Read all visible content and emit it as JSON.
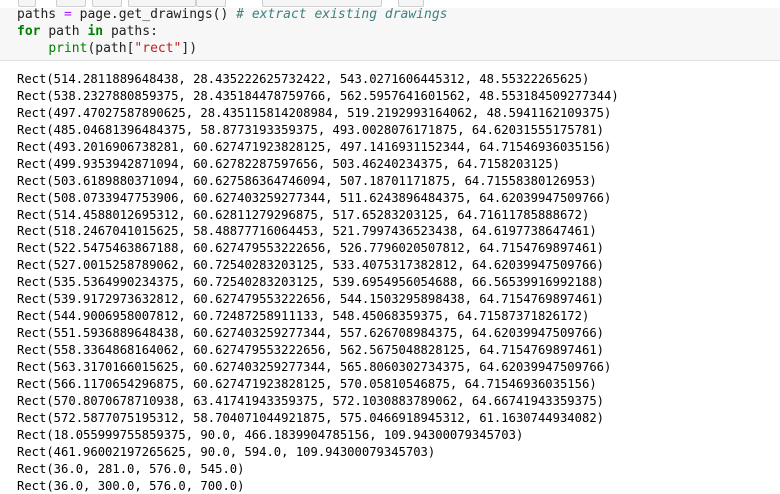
{
  "code": {
    "line1": {
      "lhs": "paths",
      "eq": "=",
      "rhs": "page.get_drawings()",
      "comment": "# extract existing drawings"
    },
    "line2": {
      "kw_for": "for",
      "var": "path",
      "kw_in": "in",
      "iter": "paths:"
    },
    "line3": {
      "indent": "    ",
      "fn": "print",
      "open": "(path[",
      "str": "\"rect\"",
      "close": "])"
    }
  },
  "output_lines": [
    "Rect(514.2811889648438, 28.435222625732422, 543.0271606445312, 48.55322265625)",
    "Rect(538.2327880859375, 28.435184478759766, 562.5957641601562, 48.553184509277344)",
    "Rect(497.47027587890625, 28.435115814208984, 519.2192993164062, 48.5941162109375)",
    "Rect(485.04681396484375, 58.8773193359375, 493.0028076171875, 64.62031555175781)",
    "Rect(493.2016906738281, 60.627471923828125, 497.1416931152344, 64.71546936035156)",
    "Rect(499.9353942871094, 60.62782287597656, 503.46240234375, 64.7158203125)",
    "Rect(503.6189880371094, 60.627586364746094, 507.18701171875, 64.71558380126953)",
    "Rect(508.0733947753906, 60.627403259277344, 511.6243896484375, 64.62039947509766)",
    "Rect(514.4588012695312, 60.62811279296875, 517.65283203125, 64.71611785888672)",
    "Rect(518.2467041015625, 58.48877716064453, 521.7997436523438, 64.6197738647461)",
    "Rect(522.5475463867188, 60.627479553222656, 526.7796020507812, 64.7154769897461)",
    "Rect(527.0015258789062, 60.72540283203125, 533.4075317382812, 64.62039947509766)",
    "Rect(535.5364990234375, 60.72540283203125, 539.6954956054688, 66.56539916992188)",
    "Rect(539.9172973632812, 60.627479553222656, 544.1503295898438, 64.7154769897461)",
    "Rect(544.9006958007812, 60.72487258911133, 548.45068359375, 64.71587371826172)",
    "Rect(551.5936889648438, 60.627403259277344, 557.626708984375, 64.62039947509766)",
    "Rect(558.3364868164062, 60.627479553222656, 562.5675048828125, 64.7154769897461)",
    "Rect(563.3170166015625, 60.627403259277344, 565.8060302734375, 64.62039947509766)",
    "Rect(566.1170654296875, 60.627471923828125, 570.05810546875, 64.71546936035156)",
    "Rect(570.8070678710938, 63.41741943359375, 572.1030883789062, 64.66741943359375)",
    "Rect(572.5877075195312, 58.704071044921875, 575.0466918945312, 61.1630744934082)",
    "Rect(18.055999755859375, 90.0, 466.1839904785156, 109.94300079345703)",
    "Rect(461.96002197265625, 90.0, 594.0, 109.94300079345703)",
    "Rect(36.0, 281.0, 576.0, 545.0)",
    "Rect(36.0, 300.0, 576.0, 700.0)"
  ]
}
